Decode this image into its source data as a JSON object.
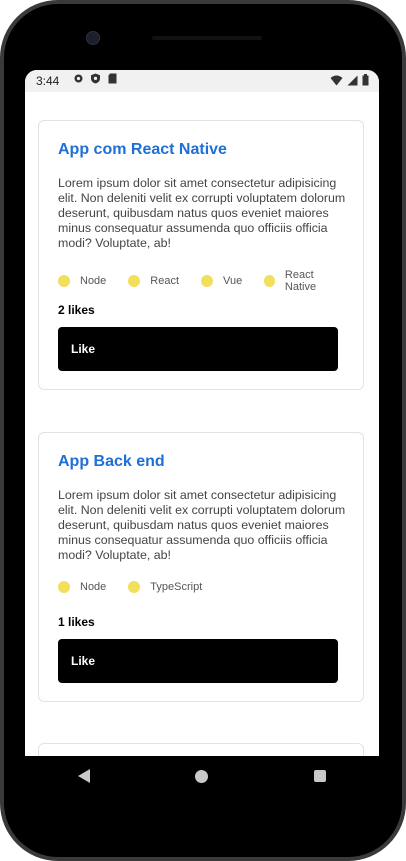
{
  "status_bar": {
    "time": "3:44",
    "left_icons": [
      "gear-icon",
      "shield-icon",
      "sd-card-icon"
    ],
    "right_icons": [
      "wifi-icon",
      "signal-icon",
      "battery-icon"
    ]
  },
  "repositories": [
    {
      "title": "App com React Native",
      "description": "Lorem ipsum dolor sit amet consectetur adipisicing elit. Non deleniti velit ex corrupti voluptatem dolorum deserunt, quibusdam natus quos eveniet maiores minus consequatur assumenda quo officiis officia modi? Voluptate, ab!",
      "techs": [
        "Node",
        "React",
        "Vue",
        "React Native"
      ],
      "likes": "2 likes",
      "like_label": "Like"
    },
    {
      "title": "App Back end",
      "description": "Lorem ipsum dolor sit amet consectetur adipisicing elit. Non deleniti velit ex corrupti voluptatem dolorum deserunt, quibusdam natus quos eveniet maiores minus consequatur assumenda quo officiis officia modi? Voluptate, ab!",
      "techs": [
        "Node",
        "TypeScript"
      ],
      "likes": "1 likes",
      "like_label": "Like"
    }
  ],
  "colors": {
    "title": "#1e6fd6",
    "tech_dot": "#f2df5b",
    "button": "#000000"
  },
  "nav_bar": [
    "back-icon",
    "home-icon",
    "recents-icon"
  ]
}
